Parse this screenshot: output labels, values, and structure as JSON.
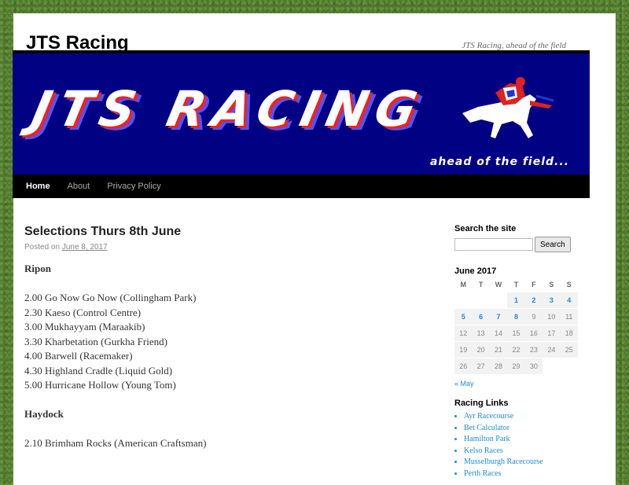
{
  "site": {
    "title": "JTS Racing",
    "description": "JTS Racing, ahead of the field",
    "banner_text": "JTS RACING",
    "banner_tagline": "ahead of the field..."
  },
  "nav": {
    "items": [
      {
        "label": "Home"
      },
      {
        "label": "About"
      },
      {
        "label": "Privacy Policy"
      }
    ]
  },
  "post": {
    "title": "Selections Thurs 8th June",
    "posted_on_label": "Posted on",
    "date": "June 8, 2017",
    "meetings": [
      {
        "course": "Ripon",
        "races": [
          "2.00 Go Now Go Now (Collingham Park)",
          "2.30 Kaeso (Control Centre)",
          "3.00 Mukhayyam (Maraakib)",
          "3.30 Kharbetation (Gurkha Friend)",
          "4.00 Barwell (Racemaker)",
          "4.30 Highland Cradle (Liquid Gold)",
          "5.00 Hurricane Hollow (Young Tom)"
        ]
      },
      {
        "course": "Haydock",
        "races": [
          "2.10 Brimham Rocks (American Craftsman)"
        ]
      }
    ]
  },
  "sidebar": {
    "search": {
      "title": "Search the site",
      "placeholder": "",
      "button_label": "Search"
    },
    "calendar": {
      "caption": "June 2017",
      "weekdays": [
        "M",
        "T",
        "W",
        "T",
        "F",
        "S",
        "S"
      ],
      "weeks": [
        [
          {
            "d": ""
          },
          {
            "d": ""
          },
          {
            "d": ""
          },
          {
            "d": "1",
            "link": true
          },
          {
            "d": "2",
            "link": true
          },
          {
            "d": "3",
            "link": true
          },
          {
            "d": "4",
            "link": true
          }
        ],
        [
          {
            "d": "5",
            "link": true
          },
          {
            "d": "6",
            "link": true
          },
          {
            "d": "7",
            "link": true
          },
          {
            "d": "8",
            "link": true
          },
          {
            "d": "9"
          },
          {
            "d": "10"
          },
          {
            "d": "11"
          }
        ],
        [
          {
            "d": "12"
          },
          {
            "d": "13"
          },
          {
            "d": "14"
          },
          {
            "d": "15"
          },
          {
            "d": "16"
          },
          {
            "d": "17"
          },
          {
            "d": "18"
          }
        ],
        [
          {
            "d": "19"
          },
          {
            "d": "20"
          },
          {
            "d": "21"
          },
          {
            "d": "22"
          },
          {
            "d": "23"
          },
          {
            "d": "24"
          },
          {
            "d": "25"
          }
        ],
        [
          {
            "d": "26"
          },
          {
            "d": "27"
          },
          {
            "d": "28"
          },
          {
            "d": "29"
          },
          {
            "d": "30"
          },
          {
            "d": ""
          },
          {
            "d": ""
          }
        ]
      ],
      "prev_label": "« May"
    },
    "racing_links": {
      "title": "Racing Links",
      "items": [
        "Ayr Racecourse",
        "Bet Calculator",
        "Hamilton Park",
        "Kelso Races",
        "Musselburgh Racecourse",
        "Perth Races"
      ]
    }
  },
  "colors": {
    "banner_bg": "#010184",
    "link": "#1b8be0",
    "nav_bg": "#000000"
  }
}
